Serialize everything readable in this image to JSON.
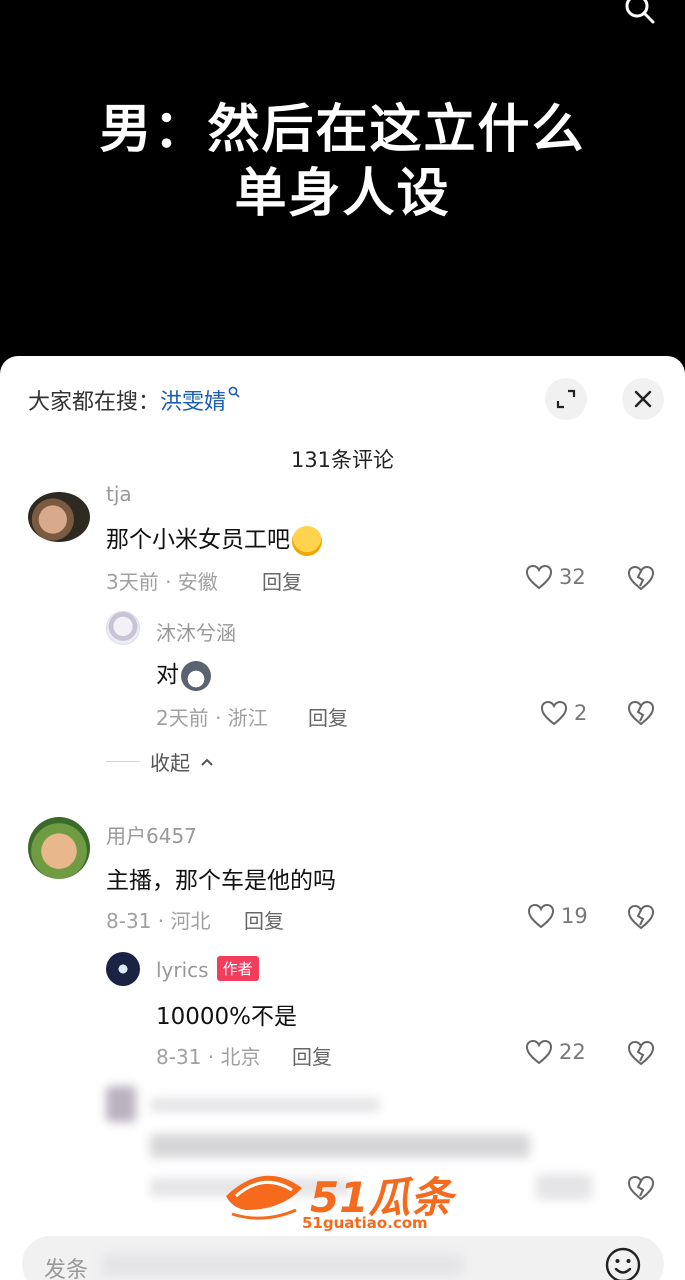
{
  "video": {
    "caption_line1": "男：然后在这立什么",
    "caption_line2": "单身人设",
    "search_icon": "search-icon"
  },
  "sheet": {
    "hot_prefix": "大家都在搜：",
    "hot_keyword": "洪雯婧",
    "comment_count": "131条评论",
    "collapse_label": "收起"
  },
  "comments": [
    {
      "user": "tja",
      "text": "那个小米女员工吧",
      "emoji": "laughing-crying-emoji",
      "date": "3天前 · 安徽",
      "reply": "回复",
      "likes": "32"
    },
    {
      "user": "沐沐兮涵",
      "text": "对",
      "emoji": "husky-emoji",
      "date": "2天前 · 浙江",
      "reply": "回复",
      "likes": "2"
    },
    {
      "user": "用户6457",
      "text": "主播，那个车是他的吗",
      "date": "8-31 · 河北",
      "reply": "回复",
      "likes": "19"
    },
    {
      "user": "lyrics",
      "badge": "作者",
      "text": "10000%不是",
      "date": "8-31 · 北京",
      "reply": "回复",
      "likes": "22"
    }
  ],
  "watermark": {
    "brand": "51瓜条",
    "url": "51guatiao.com"
  },
  "input": {
    "placeholder": "发条"
  },
  "colors": {
    "badge": "#f23d5c",
    "keyword": "#1a5fb4",
    "watermark": "#f56a1c"
  }
}
